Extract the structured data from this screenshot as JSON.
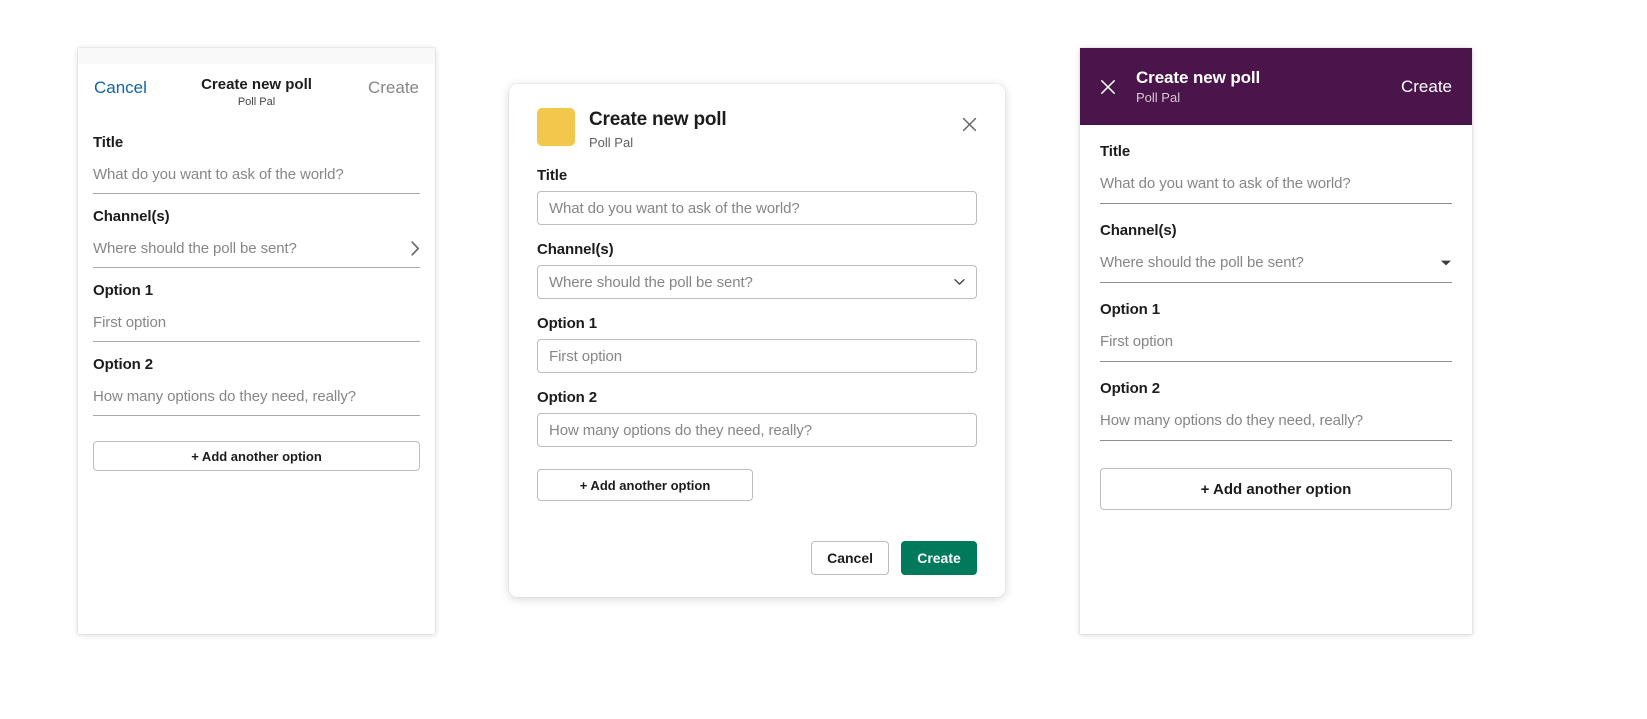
{
  "app": {
    "title": "Create new poll",
    "subtitle": "Poll Pal",
    "icon_color": "#f1c84b",
    "accent_green": "#007a5a",
    "accent_purple": "#4a154b",
    "link_blue": "#1264a3"
  },
  "fields": {
    "title": {
      "label": "Title",
      "placeholder": "What do you want to ask of the world?"
    },
    "channels": {
      "label": "Channel(s)",
      "placeholder": "Where should the poll be sent?"
    },
    "option1": {
      "label": "Option 1",
      "placeholder": "First option"
    },
    "option2": {
      "label": "Option 2",
      "placeholder": "How many options do they need, really?"
    }
  },
  "add_option_label": "+ Add another option",
  "ios_panel": {
    "cancel_label": "Cancel",
    "title": "Create new poll",
    "subtitle": "Poll Pal",
    "create_label": "Create",
    "chevron_icon": "chevron-right-icon"
  },
  "desktop_panel": {
    "title": "Create new poll",
    "subtitle": "Poll Pal",
    "close_icon": "close-icon",
    "caret_icon": "chevron-down-icon",
    "cancel_label": "Cancel",
    "create_label": "Create"
  },
  "android_panel": {
    "close_icon": "close-icon",
    "title": "Create new poll",
    "subtitle": "Poll Pal",
    "create_label": "Create",
    "caret_icon": "caret-down-icon"
  }
}
